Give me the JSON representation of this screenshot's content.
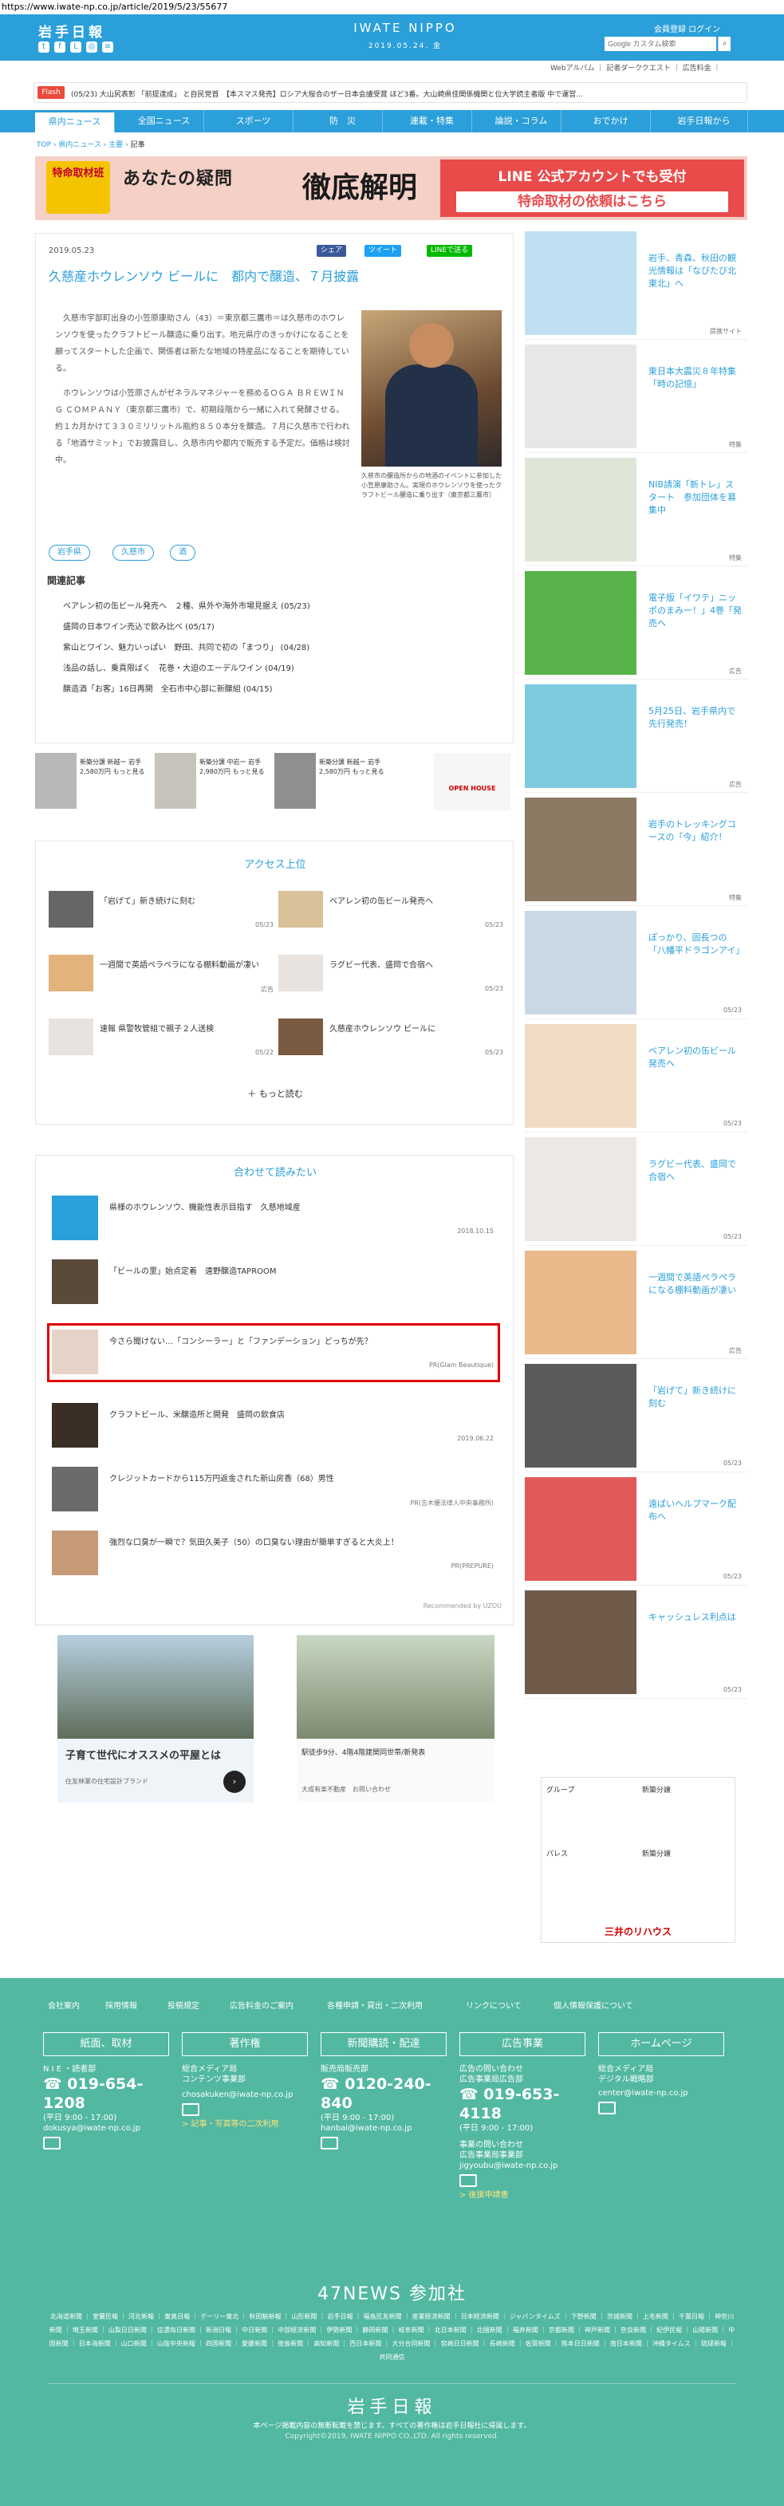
{
  "url": "https://www.iwate-np.co.jp/article/2019/5/23/55677",
  "header": {
    "logo": "岩手日報",
    "brand": "IWATE NIPPO",
    "date": "2019.05.24. 金",
    "links": "会員登録 ログイン",
    "search_placeholder": "Google カスタム検索",
    "subnav": "Webアルバム ｜ 記者ダーククエスト ｜ 広告料金 ｜"
  },
  "flash": {
    "label": "Flash",
    "text": "(05/23)  大山尻表彰 「前提達成」 と自民党首　【本スマス発売】ロシア大桜合のザー日本会議受賞 ほど3番。大山崎県佳関係機関と位大学読主者版 中で運営..."
  },
  "nav": [
    "県内ニュース",
    "全国ニュース",
    "スポーツ",
    "防　災",
    "連載・特集",
    "論説・コラム",
    "おでかけ",
    "岩手日報から"
  ],
  "breadcrumb": {
    "top": "TOP",
    "cat": "県内ニュース",
    "sub": "主要",
    "current": "記事"
  },
  "banner": {
    "left": "特命取材班",
    "mid": "あなたの疑問",
    "title": "徹底解明",
    "right1": "LINE 公式アカウントでも受付",
    "right2": "特命取材の依頼はこちら"
  },
  "article": {
    "date": "2019.05.23",
    "share": [
      "シェア",
      "ツイート",
      "LINEで送る"
    ],
    "title": "久慈産ホウレンソウ ビールに　都内で醸造、７月披露",
    "body1": "久慈市宇部町出身の小笠原康助さん（43）＝東京都三鷹市＝は久慈市のホウレンソウを使ったクラフトビール醸造に乗り出す。地元県庁のきっかけになることを願ってスタートした企画で、関係者は新たな地域の特産品になることを期待している。",
    "body2": "ホウレンソウは小笠原さんがゼネラルマネジャーを務めるＯＧＡ ＢＲＥＷＩＮＧ ＣＯＭＰＡＮＹ（東京都三鷹市）で、初期段階から一緒に入れて発酵させる。約１カ月かけて３３０ミリリットル瓶約８５０本分を醸造。７月に久慈市で行われる「地酒サミット」でお披露目し、久慈市内や都内で販売する予定だ。価格は検討中。",
    "caption": "久慈市の醸造所からの地酒のイベントに参加した小笠原康助さん。実現のホウレンソウを使ったクラフトビール醸造に乗り出す（東京都三鷹市）",
    "tags": [
      "岩手県",
      "久慈市",
      "酒"
    ],
    "related_heading": "関連記事",
    "related": [
      "ベアレン初の缶ビール発売へ　２種、県外や海外市場見据え (05/23)",
      "盛岡の日本ワイン売込で飲み比べ (05/17)",
      "紫山とワイン、魅力いっぱい　野田、共同で初の「まつり」 (04/28)",
      "浅品の話し、乗貢限ばく　花巻・大迫のエーデルワイン (04/19)",
      "醸造酒「お客」16日再開　全石市中心部に新醸組 (04/15)"
    ]
  },
  "ads_row": [
    {
      "text": "新築分譲 新越ー 岩手 2,580万円 もっと見る"
    },
    {
      "text": "新築分譲 中岩ー 岩手 2,980万円 もっと見る"
    },
    {
      "text": "新築分譲 新越ー 岩手 2,580万円 もっと見る"
    },
    {
      "text": "OPEN HOUSE"
    }
  ],
  "access": {
    "heading": "アクセス上位",
    "items": [
      {
        "title": "「岩げて」新き続けに刻む",
        "date": "05/23"
      },
      {
        "title": "ベアレン初の缶ビール発売へ",
        "date": "05/23"
      },
      {
        "title": "一週間で英語ペラペラになる棚料動画が凄い",
        "date": "広告"
      },
      {
        "title": "ラグビー代表、盛岡で合宿へ",
        "date": "05/23"
      },
      {
        "title": "速報 県警牧管組で親子２人送検",
        "date": "05/22"
      },
      {
        "title": "久慈産ホウレンソウ ビールに",
        "date": "05/23"
      }
    ],
    "more": "もっと読む"
  },
  "recommend": {
    "heading": "合わせて読みたい",
    "items": [
      {
        "title": "県様のホウレンソウ、機能性表示目指す　久慈地域産",
        "meta": "2018.10.15"
      },
      {
        "title": "「ビールの里」始点定着　遠野醸造TAPROOM",
        "meta": ""
      },
      {
        "title": "今さら聞けない…「コンシーラー」と「ファンデーション」どっちが先？",
        "meta": "PR(Glam Beautique)"
      },
      {
        "title": "クラフトビール、米醸造所と開発　盛岡の飲食店",
        "meta": "2019.06.22"
      },
      {
        "title": "クレジットカードから115万円返金された新山房香（68）男性",
        "meta": "PR(吉木優法律人中央事務所)"
      },
      {
        "title": "強烈な口臭が一瞬で？気田久美子（50）の口臭ない理由が簡単すぎると大炎上！",
        "meta": "PR(PREPURE)"
      }
    ],
    "credit": "Recommended by UZOU"
  },
  "bottom_ads": [
    {
      "title": "子育て世代にオススメの平屋とは",
      "sub": "住友林業の住宅設計ブランド"
    },
    {
      "title": "駅徒歩9分、4階4階建関同世帯/新発表",
      "sub": "大成有楽不動産　お問い合わせ"
    }
  ],
  "sidebar": [
    {
      "title": "岩手、青森、秋田の観光情報は「なびたび北東北」へ",
      "cat": "提携サイト"
    },
    {
      "title": "東日本大震災８年特集「時の記憶」",
      "cat": "特集"
    },
    {
      "title": "NIB請演「新トレ」スタート　参加団体を募集中",
      "cat": "特集"
    },
    {
      "title": "電子版「イワテ」ニッポのまみー！」4巻「発売へ",
      "cat": "広告"
    },
    {
      "title": "5月25日、岩手県内で先行発売！",
      "cat": "広告"
    },
    {
      "title": "岩手のトレッキングコースの「今」紹介！",
      "cat": "特集"
    },
    {
      "title": "ぽっかり、固長つの「八幡平ドラゴンアイ」",
      "cat": "05/23"
    },
    {
      "title": "ベアレン初の缶ビール発売へ",
      "cat": "05/23"
    },
    {
      "title": "ラグビー代表、盛岡で合宿へ",
      "cat": "05/23"
    },
    {
      "title": "一週間で英語ペラペラになる棚料動画が凄い",
      "cat": "広告"
    },
    {
      "title": "「岩げて」新き続けに刻む",
      "cat": "05/23"
    },
    {
      "title": "遠ぱいヘルプマーク配布へ",
      "cat": "05/23"
    },
    {
      "title": "キャッシュレス利点は",
      "cat": "05/23"
    }
  ],
  "sidead": {
    "brand": "三井のリハウス",
    "labels": [
      "グループ",
      "新築分譲",
      "パレス",
      "新築分譲"
    ]
  },
  "footer": {
    "links": [
      "会社案内",
      "採用情報",
      "投稿規定",
      "広告料金のご案内",
      "各種申請・貸出・二次利用",
      "リンクについて",
      "個人情報保護について"
    ],
    "boxes": [
      "紙面、取材",
      "著作権",
      "新聞購読・配達",
      "広告事業",
      "ホームページ"
    ],
    "col1": {
      "line1": "N I E ・読者部",
      "phone": "019-654-1208",
      "hours": "(平日 9:00 - 17:00)",
      "mail": "dokusya@iwate-np.co.jp"
    },
    "col2": {
      "line1": "総合メディア局",
      "line2": "コンテンツ事業部",
      "mail": "chosakuken@iwate-np.co.jp",
      "link": "> 記事・写真等の二次利用"
    },
    "col3": {
      "line1": "販売局販売部",
      "phone": "0120-240-840",
      "hours": "(平日 9:00 - 17:00)",
      "mail": "hanbai@iwate-np.co.jp"
    },
    "col4": {
      "line1": "広告の問い合わせ",
      "line2": "広告事業局広告部",
      "phone": "019-653-4118",
      "hours": "(平日 9:00 - 17:00)",
      "line3": "事業の問い合わせ",
      "line4": "広告事業局事業部",
      "mail": "jigyoubu@iwate-np.co.jp",
      "link": "> 後援申請書"
    },
    "col5": {
      "line1": "総合メディア局",
      "line2": "デジタル戦略部",
      "mail": "center@iwate-np.co.jp"
    },
    "news47": "47NEWS 参加社",
    "members": "北海道新聞 ｜ 室蘭民報 ｜ 河北新報 ｜ 東奥日報 ｜ デーリー東北 ｜ 秋田魁新報 ｜ 山形新聞 ｜ 岩手日報 ｜ 福島民友新聞 ｜ 産業経済新聞 ｜ 日本経済新聞 ｜ ジャパンタイムズ ｜ 下野新聞 ｜ 茨城新聞 ｜ 上毛新聞 ｜ 千葉日報 ｜ 神奈川新聞 ｜ 埼玉新聞 ｜ 山梨日日新聞 ｜ 信濃毎日新聞 ｜ 新潟日報 ｜ 中日新聞 ｜ 中部経済新聞 ｜ 伊勢新聞 ｜ 静岡新聞 ｜ 岐阜新聞 ｜ 北日本新聞 ｜ 北國新聞 ｜ 福井新聞 ｜ 京都新聞 ｜ 神戸新聞 ｜ 奈良新聞 ｜ 紀伊民報 ｜ 山陽新聞 ｜ 中国新聞 ｜ 日本海新聞 ｜ 山口新聞 ｜ 山陰中央新報 ｜ 四国新聞 ｜ 愛媛新聞 ｜ 徳島新聞 ｜ 高知新聞 ｜ 西日本新聞 ｜ 大分合同新聞 ｜ 宮崎日日新聞 ｜ 長崎新聞 ｜ 佐賀新聞 ｜ 熊本日日新聞 ｜ 南日本新聞 ｜ 沖縄タイムス ｜ 琉球新報 ｜ 共同通信",
    "logo": "岩手日報",
    "note": "本ページ掲載内容の無断転載を禁じます。すべての著作権は岩手日報社に帰属します。",
    "copyright": "Copyright©2019, IWATE NIPPO CO.,LTD. All rights reserved."
  }
}
